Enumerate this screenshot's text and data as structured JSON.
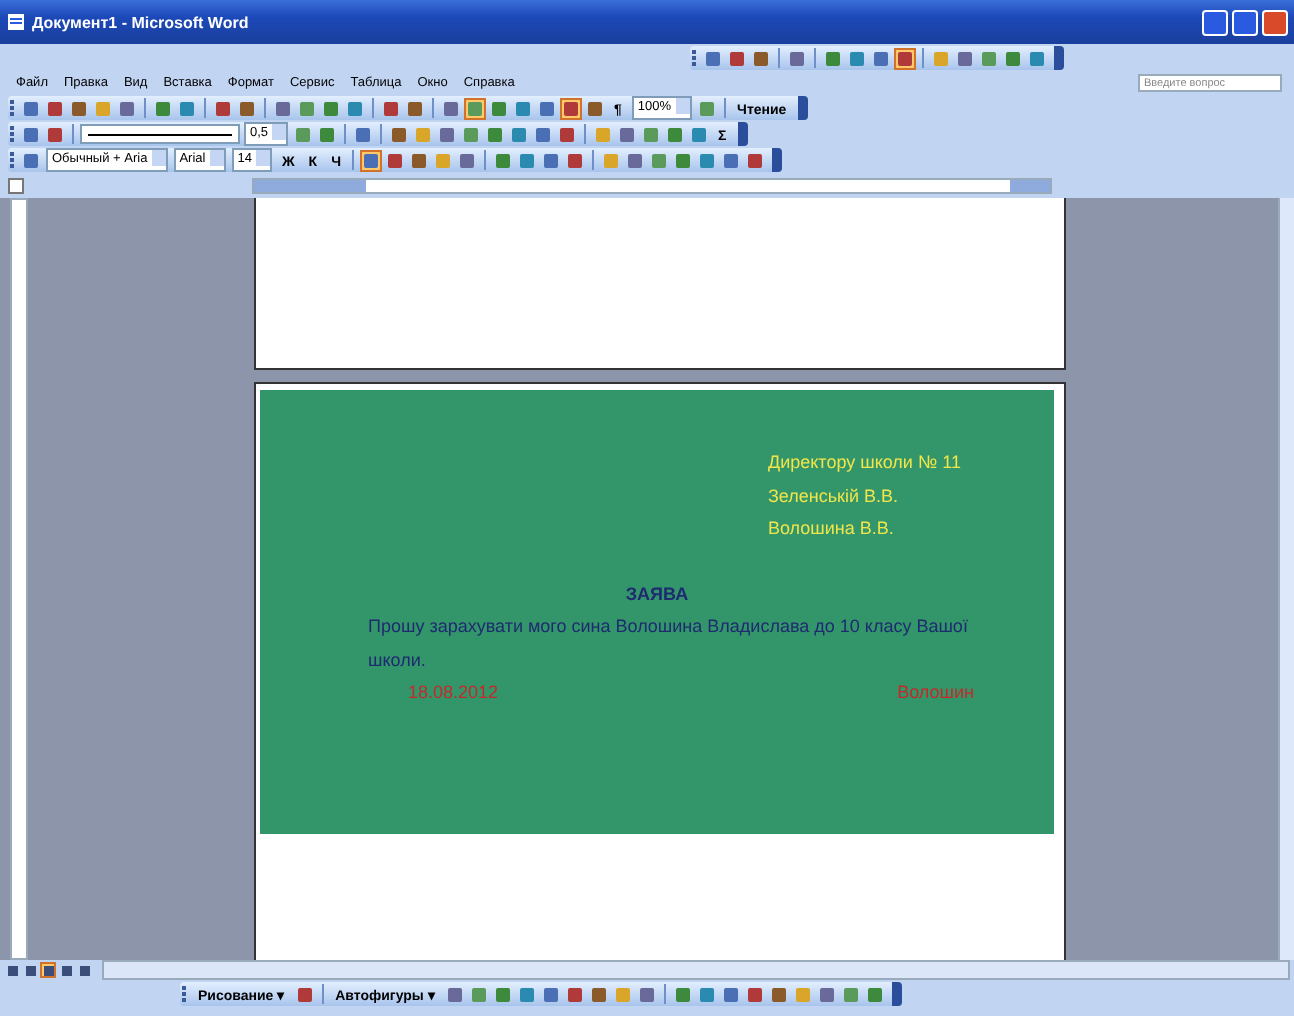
{
  "window": {
    "title": "Документ1 - Microsoft Word"
  },
  "floating_toolbar": [
    {
      "kind": "button",
      "selected": false
    },
    {
      "kind": "button",
      "selected": false
    },
    {
      "kind": "button",
      "selected": false
    },
    {
      "kind": "sep"
    },
    {
      "kind": "button",
      "selected": false
    },
    {
      "kind": "sep"
    },
    {
      "kind": "button",
      "selected": false
    },
    {
      "kind": "button",
      "selected": false
    },
    {
      "kind": "button",
      "selected": false
    },
    {
      "kind": "button",
      "selected": true
    },
    {
      "kind": "sep"
    },
    {
      "kind": "button",
      "selected": false
    },
    {
      "kind": "button",
      "selected": false
    },
    {
      "kind": "button",
      "selected": false
    },
    {
      "kind": "button",
      "selected": false
    },
    {
      "kind": "button",
      "selected": false
    }
  ],
  "menu": [
    "Файл",
    "Правка",
    "Вид",
    "Вставка",
    "Формат",
    "Сервис",
    "Таблица",
    "Окно",
    "Справка"
  ],
  "help_field": {
    "placeholder": "Введите вопрос"
  },
  "standard_toolbar": [
    {
      "kind": "button",
      "selected": false
    },
    {
      "kind": "button",
      "selected": false
    },
    {
      "kind": "button",
      "selected": false
    },
    {
      "kind": "button",
      "selected": false
    },
    {
      "kind": "button",
      "selected": false
    },
    {
      "kind": "sep"
    },
    {
      "kind": "button",
      "selected": false
    },
    {
      "kind": "button",
      "selected": false
    },
    {
      "kind": "sep"
    },
    {
      "kind": "button",
      "selected": false
    },
    {
      "kind": "button",
      "selected": false
    },
    {
      "kind": "sep"
    },
    {
      "kind": "button",
      "selected": false
    },
    {
      "kind": "button",
      "selected": false
    },
    {
      "kind": "button",
      "selected": false
    },
    {
      "kind": "button",
      "selected": false
    },
    {
      "kind": "sep"
    },
    {
      "kind": "button",
      "selected": false
    },
    {
      "kind": "button",
      "selected": false
    },
    {
      "kind": "sep"
    },
    {
      "kind": "button",
      "selected": false
    },
    {
      "kind": "button",
      "selected": true
    },
    {
      "kind": "button",
      "selected": false
    },
    {
      "kind": "button",
      "selected": false
    },
    {
      "kind": "button",
      "selected": false
    },
    {
      "kind": "button",
      "selected": true
    },
    {
      "kind": "button",
      "selected": false
    },
    {
      "kind": "text",
      "label": "¶",
      "selected": false
    },
    {
      "kind": "combo",
      "value": "100%"
    },
    {
      "kind": "button",
      "selected": false
    },
    {
      "kind": "sep"
    },
    {
      "kind": "text",
      "label": "Чтение",
      "selected": false
    }
  ],
  "tables_toolbar": [
    {
      "kind": "button",
      "selected": false
    },
    {
      "kind": "button",
      "selected": false
    },
    {
      "kind": "sep"
    },
    {
      "kind": "line"
    },
    {
      "kind": "combo",
      "value": "0,5"
    },
    {
      "kind": "button",
      "selected": false
    },
    {
      "kind": "button",
      "selected": false
    },
    {
      "kind": "sep"
    },
    {
      "kind": "button",
      "selected": false
    },
    {
      "kind": "sep"
    },
    {
      "kind": "button",
      "selected": false
    },
    {
      "kind": "button",
      "selected": false
    },
    {
      "kind": "button",
      "selected": false
    },
    {
      "kind": "button",
      "selected": false
    },
    {
      "kind": "button",
      "selected": false
    },
    {
      "kind": "button",
      "selected": false
    },
    {
      "kind": "button",
      "selected": false
    },
    {
      "kind": "button",
      "selected": false
    },
    {
      "kind": "sep"
    },
    {
      "kind": "button",
      "selected": false
    },
    {
      "kind": "button",
      "selected": false
    },
    {
      "kind": "button",
      "selected": false
    },
    {
      "kind": "button",
      "selected": false
    },
    {
      "kind": "button",
      "selected": false
    },
    {
      "kind": "text",
      "label": "Σ",
      "selected": false
    }
  ],
  "formatting_toolbar": [
    {
      "kind": "button",
      "selected": false
    },
    {
      "kind": "combo",
      "value": "Обычный + Aria"
    },
    {
      "kind": "combo",
      "value": "Arial"
    },
    {
      "kind": "combo",
      "value": "14"
    },
    {
      "kind": "text",
      "label": "Ж",
      "selected": false
    },
    {
      "kind": "text",
      "label": "К",
      "selected": false
    },
    {
      "kind": "text",
      "label": "Ч",
      "selected": false
    },
    {
      "kind": "sep"
    },
    {
      "kind": "button",
      "selected": true
    },
    {
      "kind": "button",
      "selected": false
    },
    {
      "kind": "button",
      "selected": false
    },
    {
      "kind": "button",
      "selected": false
    },
    {
      "kind": "button",
      "selected": false
    },
    {
      "kind": "sep"
    },
    {
      "kind": "button",
      "selected": false
    },
    {
      "kind": "button",
      "selected": false
    },
    {
      "kind": "button",
      "selected": false
    },
    {
      "kind": "button",
      "selected": false
    },
    {
      "kind": "sep"
    },
    {
      "kind": "button",
      "selected": false
    },
    {
      "kind": "button",
      "selected": false
    },
    {
      "kind": "button",
      "selected": false
    },
    {
      "kind": "button",
      "selected": false
    },
    {
      "kind": "button",
      "selected": false
    },
    {
      "kind": "button",
      "selected": false
    },
    {
      "kind": "button",
      "selected": false
    }
  ],
  "document": {
    "lines": [
      {
        "kind": "address",
        "text": "Директору школи № 11"
      },
      {
        "kind": "address",
        "text": "Зеленській В.В."
      },
      {
        "kind": "address",
        "text": "Волошина В.В."
      },
      {
        "kind": "title",
        "text": "ЗАЯВА"
      },
      {
        "kind": "body",
        "text": "Прошу зарахувати мого сина Волошина Владислава до 10 класу Вашої школи."
      },
      {
        "kind": "sign",
        "date": "18.08.2012",
        "name": "Волошин"
      }
    ]
  },
  "view_buttons": [
    {
      "selected": false
    },
    {
      "selected": false
    },
    {
      "selected": true
    },
    {
      "selected": false
    },
    {
      "selected": false
    }
  ],
  "drawing_toolbar": [
    {
      "kind": "text",
      "label": "Рисование ▾",
      "selected": false
    },
    {
      "kind": "button",
      "selected": false
    },
    {
      "kind": "sep"
    },
    {
      "kind": "text",
      "label": "Автофигуры ▾",
      "selected": false
    },
    {
      "kind": "button",
      "selected": false
    },
    {
      "kind": "button",
      "selected": false
    },
    {
      "kind": "button",
      "selected": false
    },
    {
      "kind": "button",
      "selected": false
    },
    {
      "kind": "button",
      "selected": false
    },
    {
      "kind": "button",
      "selected": false
    },
    {
      "kind": "button",
      "selected": false
    },
    {
      "kind": "button",
      "selected": false
    },
    {
      "kind": "button",
      "selected": false
    },
    {
      "kind": "sep"
    },
    {
      "kind": "button",
      "selected": false
    },
    {
      "kind": "button",
      "selected": false
    },
    {
      "kind": "button",
      "selected": false
    },
    {
      "kind": "button",
      "selected": false
    },
    {
      "kind": "button",
      "selected": false
    },
    {
      "kind": "button",
      "selected": false
    },
    {
      "kind": "button",
      "selected": false
    },
    {
      "kind": "button",
      "selected": false
    },
    {
      "kind": "button",
      "selected": false
    }
  ]
}
